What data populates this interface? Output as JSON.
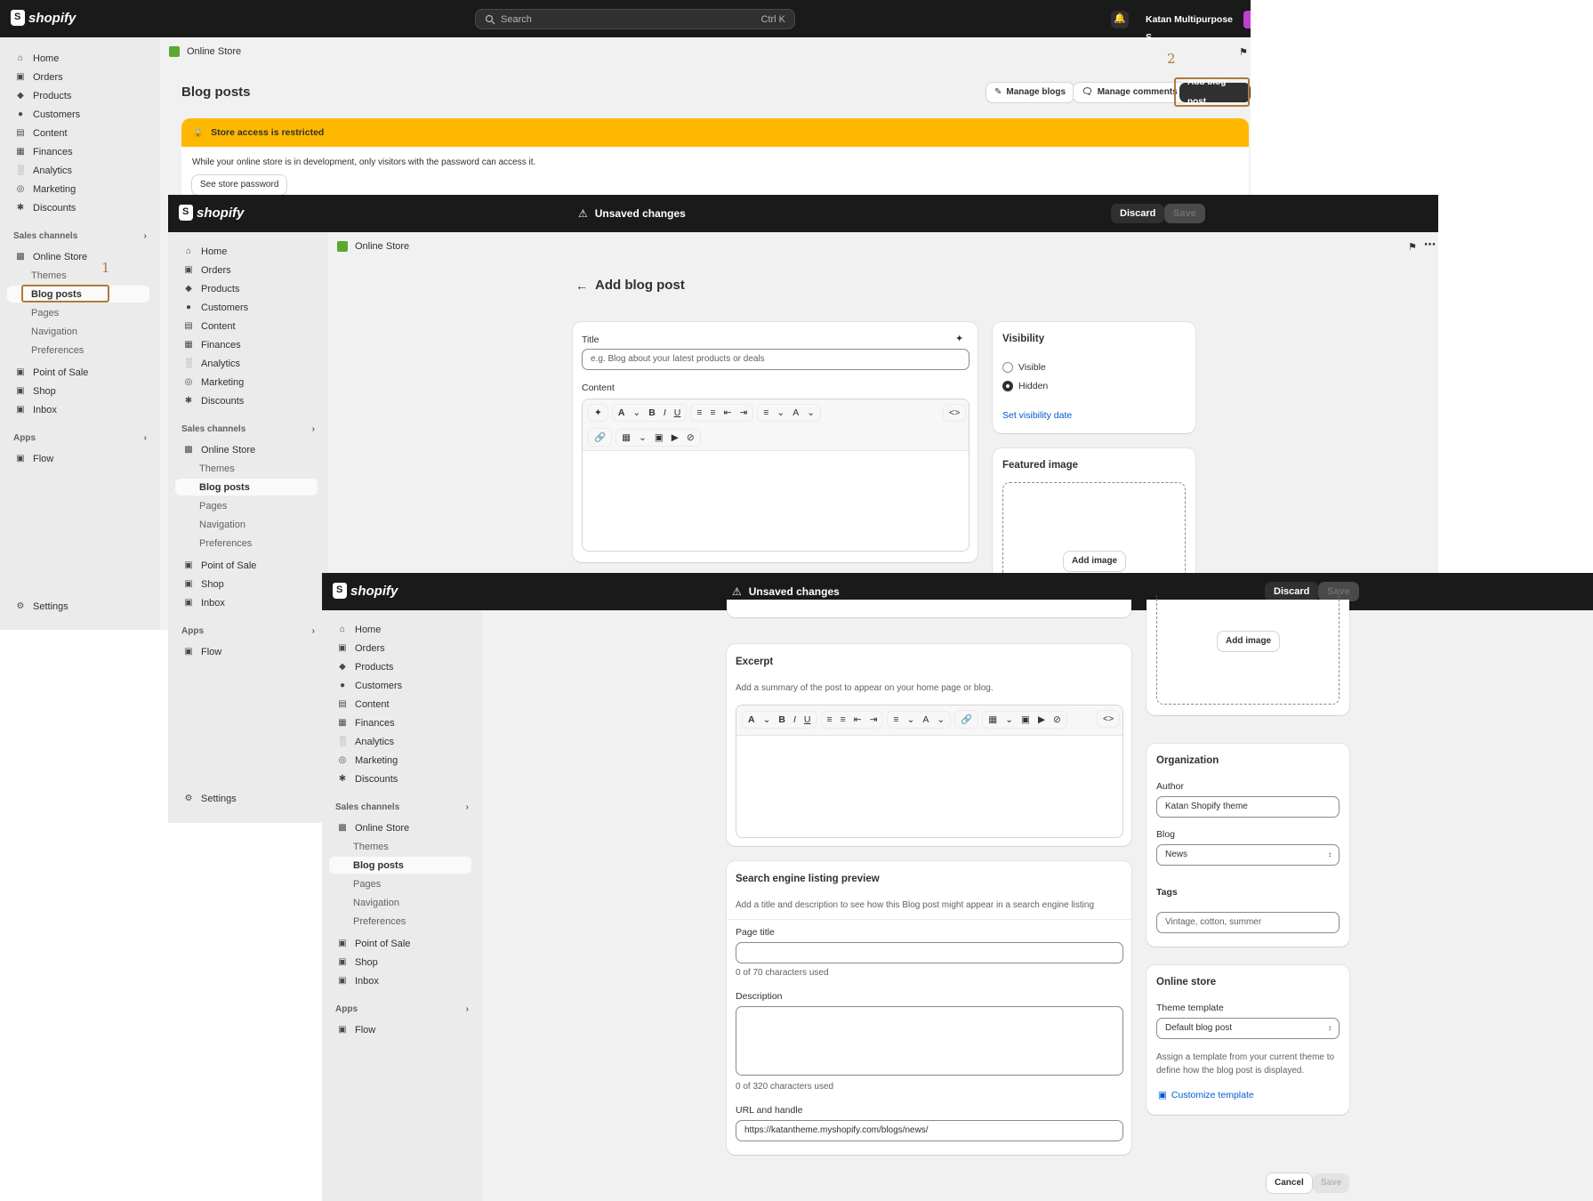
{
  "brand": {
    "logo_text": "shopify"
  },
  "search": {
    "placeholder": "Search",
    "shortcut": "Ctrl K"
  },
  "store_menu": {
    "name": "Katan Multipurpose S..."
  },
  "nav": {
    "home": "Home",
    "orders": "Orders",
    "products": "Products",
    "customers": "Customers",
    "content": "Content",
    "finances": "Finances",
    "analytics": "Analytics",
    "marketing": "Marketing",
    "discounts": "Discounts",
    "sales_channels": "Sales channels",
    "online_store": "Online Store",
    "themes": "Themes",
    "blog_posts": "Blog posts",
    "pages": "Pages",
    "navigation": "Navigation",
    "preferences": "Preferences",
    "pos": "Point of Sale",
    "shop": "Shop",
    "inbox": "Inbox",
    "apps": "Apps",
    "flow": "Flow",
    "settings": "Settings"
  },
  "annotations": {
    "step1": "1",
    "step2": "2"
  },
  "blog_list": {
    "breadcrumb": "Online Store",
    "title": "Blog posts",
    "manage_blogs": "Manage blogs",
    "manage_comments": "Manage comments",
    "add_blog_post": "Add blog post",
    "banner_title": "Store access is restricted",
    "banner_text": "While your online store is in development, only visitors with the password can access it.",
    "see_password": "See store password"
  },
  "contextual": {
    "unsaved": "Unsaved changes",
    "discard": "Discard",
    "save": "Save"
  },
  "add_post": {
    "breadcrumb": "Online Store",
    "title": "Add blog post",
    "title_label": "Title",
    "title_placeholder": "e.g. Blog about your latest products or deals",
    "content_label": "Content",
    "visibility": {
      "heading": "Visibility",
      "visible": "Visible",
      "hidden": "Hidden",
      "selected": "Hidden",
      "set_date": "Set visibility date"
    },
    "featured_image": {
      "heading": "Featured image",
      "add_image": "Add image"
    }
  },
  "add_post_lower": {
    "excerpt": {
      "heading": "Excerpt",
      "help": "Add a summary of the post to appear on your home page or blog."
    },
    "seo": {
      "heading": "Search engine listing preview",
      "help": "Add a title and description to see how this Blog post might appear in a search engine listing",
      "page_title_label": "Page title",
      "page_title_count": "0 of 70 characters used",
      "description_label": "Description",
      "description_count": "0 of 320 characters used",
      "url_label": "URL and handle",
      "url_value": "https://katantheme.myshopify.com/blogs/news/"
    },
    "add_image": "Add image",
    "organization": {
      "heading": "Organization",
      "author_label": "Author",
      "author_value": "Katan Shopify theme",
      "blog_label": "Blog",
      "blog_value": "News",
      "tags_label": "Tags",
      "tags_placeholder": "Vintage, cotton, summer"
    },
    "online_store": {
      "heading": "Online store",
      "template_label": "Theme template",
      "template_value": "Default blog post",
      "help": "Assign a template from your current theme to define how the blog post is displayed.",
      "customize": "Customize template"
    },
    "cancel": "Cancel",
    "save": "Save"
  },
  "colors": {
    "topbar": "#1a1a1a",
    "warning": "#ffb800",
    "link": "#005bd3",
    "highlight": "#b07a3a"
  }
}
